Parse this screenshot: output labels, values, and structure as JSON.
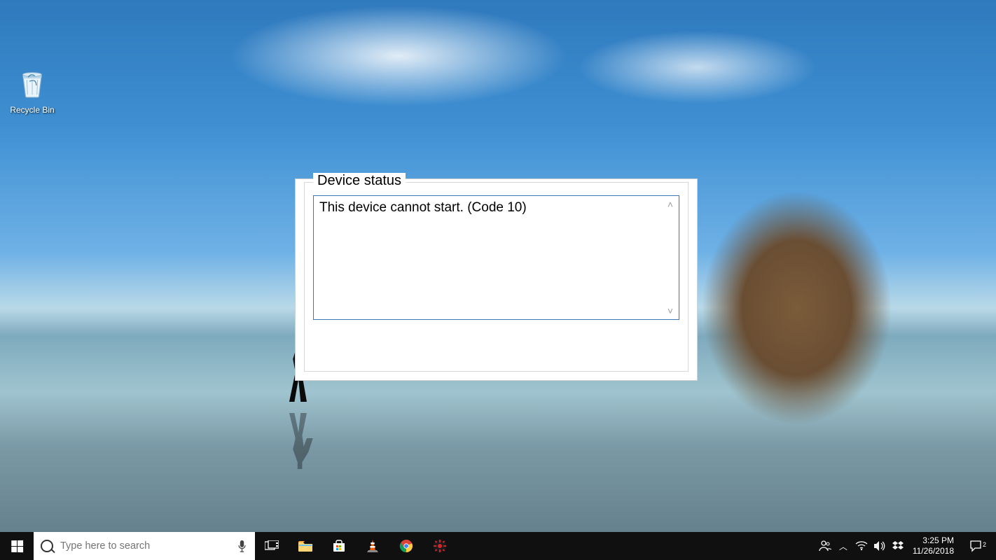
{
  "desktop": {
    "icons": [
      {
        "name": "recycle-bin",
        "label": "Recycle Bin"
      }
    ]
  },
  "dialog": {
    "legend": "Device status",
    "message": "This device cannot start. (Code 10)"
  },
  "taskbar": {
    "search_placeholder": "Type here to search",
    "pinned": [
      {
        "name": "task-view"
      },
      {
        "name": "file-explorer"
      },
      {
        "name": "microsoft-store"
      },
      {
        "name": "vlc"
      },
      {
        "name": "chrome"
      },
      {
        "name": "app-red"
      }
    ],
    "clock": {
      "time": "3:25 PM",
      "date": "11/26/2018"
    },
    "action_center_count": "2"
  }
}
